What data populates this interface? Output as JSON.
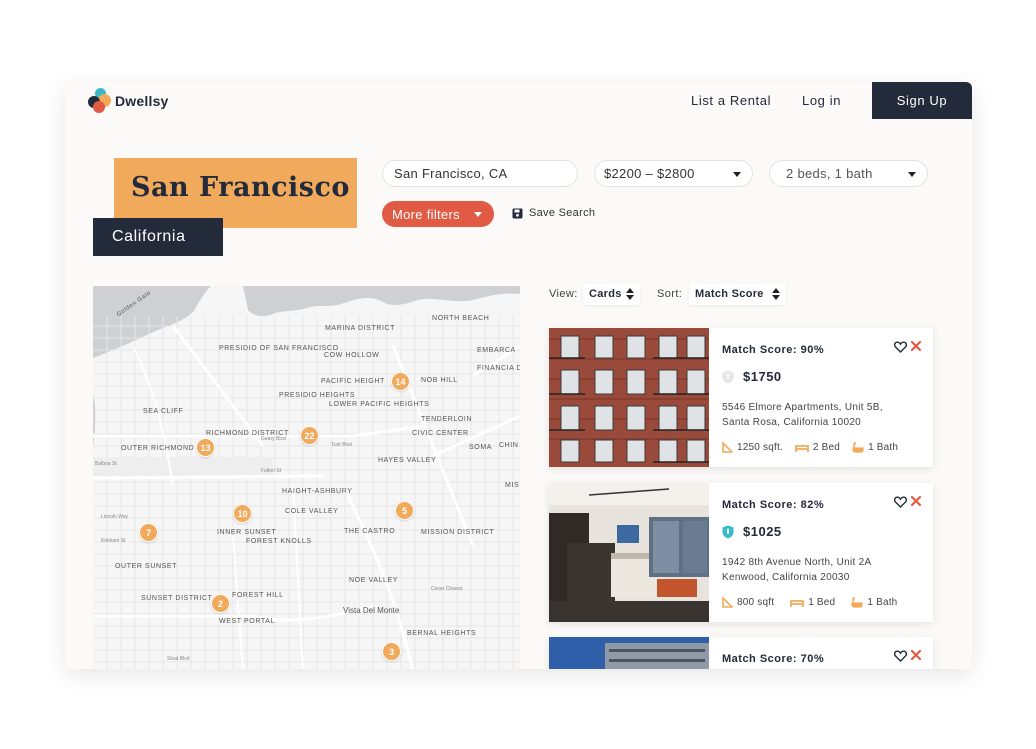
{
  "brand": {
    "name": "Dwellsy"
  },
  "nav": {
    "list_rental": "List a Rental",
    "login": "Log in",
    "signup": "Sign Up"
  },
  "hero": {
    "city": "San Francisco",
    "state": "California"
  },
  "filters": {
    "location": "San Francisco, CA",
    "price": "$2200 – $2800",
    "beds_baths": "2 beds, 1 bath",
    "more_filters": "More filters",
    "save_search": "Save Search"
  },
  "controls": {
    "view_label": "View:",
    "view_value": "Cards",
    "sort_label": "Sort:",
    "sort_value": "Match Score"
  },
  "map": {
    "neighborhoods": [
      "NORTH BEACH",
      "MARINA DISTRICT",
      "PRESIDIO OF SAN FRANCISCO",
      "COW HOLLOW",
      "EMBARCA",
      "FINANCIA DISTRIC",
      "PACIFIC HEIGHT",
      "NOB HILL",
      "PRESIDIO HEIGHTS",
      "LOWER PACIFIC HEIGHTS",
      "TENDERLOIN",
      "SEA CLIFF",
      "RICHMOND DISTRICT",
      "CIVIC CENTER",
      "OUTER RICHMOND",
      "SOMA",
      "CHIN",
      "HAYES VALLEY",
      "HAIGHT-ASHBURY",
      "COLE VALLEY",
      "MIS",
      "INNER SUNSET",
      "FOREST KNOLLS",
      "THE CASTRO",
      "MISSION DISTRICT",
      "OUTER SUNSET",
      "NOE VALLEY",
      "SUNSET DISTRICT",
      "FOREST HILL",
      "WEST PORTAL",
      "Vista Del Monte",
      "BERNAL HEIGHTS"
    ],
    "streets": [
      "Golden Gate",
      "Geary Blvd",
      "Fulton St",
      "Lincoln Way",
      "Sloat Blvd",
      "Turk Blvd",
      "Balboa St",
      "Kirkham St",
      "Cesar Chavez"
    ],
    "pins": [
      "14",
      "22",
      "13",
      "10",
      "5",
      "7",
      "2",
      "3"
    ]
  },
  "listings": [
    {
      "match": "Match Score: 90%",
      "price": "$1750",
      "verified": false,
      "address_line1": "5546 Elmore Apartments, Unit 5B,",
      "address_line2": "Santa Rosa, California 10020",
      "sqft": "1250 sqft.",
      "beds": "2 Bed",
      "baths": "1 Bath"
    },
    {
      "match": "Match Score: 82%",
      "price": "$1025",
      "verified": true,
      "address_line1": "1942 8th Avenue North, Unit 2A",
      "address_line2": "Kenwood, California 20030",
      "sqft": "800 sqft",
      "beds": "1 Bed",
      "baths": "1 Bath"
    },
    {
      "match": "Match Score: 70%"
    }
  ],
  "colors": {
    "accent_orange": "#f1aa5b",
    "navy": "#232a3a",
    "red": "#e15a44",
    "teal": "#3bb8c9"
  }
}
